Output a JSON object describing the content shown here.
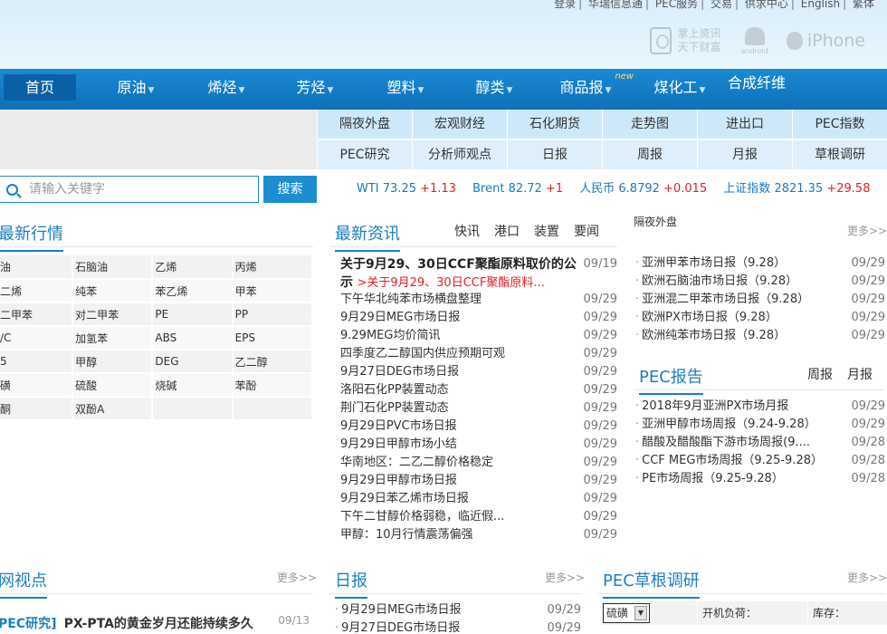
{
  "header": {
    "top_links": [
      "登录",
      "华瑞信息通",
      "PEC服务",
      "交易",
      "供求中心",
      "English",
      "繁体"
    ],
    "mobile_line1": "掌上资讯",
    "mobile_line2": "天下财富",
    "android_label": "android",
    "iphone_label": "iPhone"
  },
  "nav": {
    "items": [
      {
        "label": "首页",
        "dropdown": false
      },
      {
        "label": "原油",
        "dropdown": true
      },
      {
        "label": "烯烃",
        "dropdown": true
      },
      {
        "label": "芳烃",
        "dropdown": true
      },
      {
        "label": "塑料",
        "dropdown": true
      },
      {
        "label": "醇类",
        "dropdown": true
      },
      {
        "label": "商品报",
        "dropdown": true,
        "badge": "new"
      },
      {
        "label": "煤化工",
        "dropdown": true
      },
      {
        "label": "合成纤维",
        "dropdown": false
      }
    ]
  },
  "quick_links": [
    "隔夜外盘",
    "宏观财经",
    "石化期货",
    "走势图",
    "进出口",
    "PEC指数",
    "PEC研究",
    "分析师观点",
    "日报",
    "周报",
    "月报",
    "草根调研"
  ],
  "search": {
    "placeholder": "请输入关键字",
    "button": "搜索"
  },
  "ticker": [
    {
      "name": "WTI",
      "price": "73.25",
      "change": "+1.13"
    },
    {
      "name": "Brent",
      "price": "82.72",
      "change": "+1"
    },
    {
      "name": "人民币",
      "price": "6.8792",
      "change": "+0.015"
    },
    {
      "name": "上证指数",
      "price": "2821.35",
      "change": "+29.58"
    }
  ],
  "market": {
    "title": "最新行情",
    "rows": [
      [
        "油",
        "石脑油",
        "乙烯",
        "丙烯"
      ],
      [
        "二烯",
        "纯苯",
        "苯乙烯",
        "甲苯"
      ],
      [
        "二甲苯",
        "对二甲苯",
        "PE",
        "PP"
      ],
      [
        "/C",
        "加氢苯",
        "ABS",
        "EPS"
      ],
      [
        "5",
        "甲醇",
        "DEG",
        "乙二醇"
      ],
      [
        "磺",
        "硫酸",
        "烧碱",
        "苯酚"
      ],
      [
        "酮",
        "双酚A",
        "",
        ""
      ]
    ]
  },
  "news": {
    "title": "最新资讯",
    "tabs": [
      "快讯",
      "港口",
      "装置",
      "要闻"
    ],
    "headline_bold": "关于9月29、30日CCF聚酯原料取价的公示",
    "headline_sub": ">关于9月29、30日CCF聚酯原料...",
    "headline_date": "09/19",
    "items": [
      {
        "title": "下午华北纯苯市场横盘整理",
        "date": "09/29"
      },
      {
        "title": "9月29日MEG市场日报",
        "date": "09/29"
      },
      {
        "title": "9.29MEG均价简讯",
        "date": "09/29"
      },
      {
        "title": "四季度乙二醇国内供应预期可观",
        "date": "09/29"
      },
      {
        "title": "9月27日DEG市场日报",
        "date": "09/29"
      },
      {
        "title": "洛阳石化PP装置动态",
        "date": "09/29"
      },
      {
        "title": "荆门石化PP装置动态",
        "date": "09/29"
      },
      {
        "title": "9月29日PVC市场日报",
        "date": "09/29"
      },
      {
        "title": "9月29日甲醇市场小结",
        "date": "09/29"
      },
      {
        "title": "华南地区：二乙二醇价格稳定",
        "date": "09/29"
      },
      {
        "title": "9月29日甲醇市场日报",
        "date": "09/29"
      },
      {
        "title": "9月29日苯乙烯市场日报",
        "date": "09/29"
      },
      {
        "title": "下午二甘醇价格弱稳，临近假...",
        "date": "09/29"
      },
      {
        "title": "甲醇：10月行情震荡偏强",
        "date": "09/29"
      }
    ]
  },
  "overnight": {
    "label": "隔夜外盘",
    "more": "更多>>",
    "items": [
      {
        "title": "亚洲甲苯市场日报（9.28）",
        "date": "09/29"
      },
      {
        "title": "欧洲石脑油市场日报（9.28）",
        "date": "09/29"
      },
      {
        "title": "亚洲混二甲苯市场日报（9.28）",
        "date": "09/29"
      },
      {
        "title": "欧洲PX市场日报（9.28）",
        "date": "09/29"
      },
      {
        "title": "欧洲纯苯市场日报（9.28）",
        "date": "09/29"
      }
    ]
  },
  "pec_report": {
    "title": "PEC报告",
    "tabs": [
      "周报",
      "月报"
    ],
    "items": [
      {
        "title": "2018年9月亚洲PX市场月报",
        "date": "09/29"
      },
      {
        "title": "亚洲甲醇市场周报（9.24-9.28）",
        "date": "09/29"
      },
      {
        "title": "醋酸及醋酸酯下游市场周报(9....",
        "date": "09/28"
      },
      {
        "title": "CCF MEG市场周报（9.25-9.28）",
        "date": "09/28"
      },
      {
        "title": "PE市场周报（9.25-9.28）",
        "date": "09/28"
      }
    ]
  },
  "views": {
    "title": "网视点",
    "more": "更多>>",
    "tag": "PEC研究]",
    "item_title": "PX-PTA的黄金岁月还能持续多久",
    "item_date": "09/13"
  },
  "daily": {
    "title": "日报",
    "more": "更多>>",
    "items": [
      {
        "title": "9月29日MEG市场日报",
        "date": "09/29"
      },
      {
        "title": "9月27日DEG市场日报",
        "date": "09/29"
      }
    ]
  },
  "grassroots": {
    "title": "PEC草根调研",
    "more": "更多>>",
    "selected": "硫磺",
    "col1": "开机负荷：",
    "col2": "库存："
  },
  "colors": {
    "brand_blue": "#1b7fc2",
    "nav_blue": "#1380c8",
    "up_red": "#e02020"
  }
}
